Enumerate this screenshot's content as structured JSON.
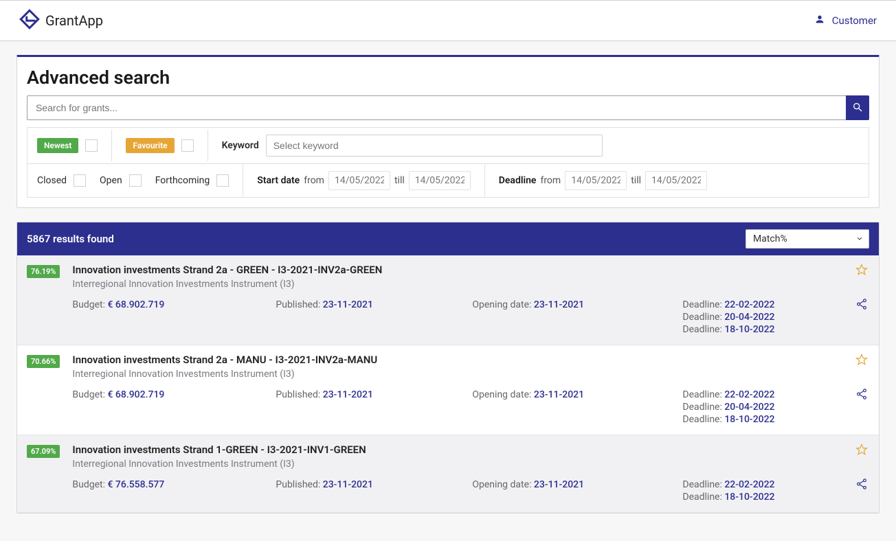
{
  "brand": {
    "name": "GrantApp"
  },
  "user": {
    "label": "Customer"
  },
  "page": {
    "title": "Advanced search"
  },
  "search": {
    "placeholder": "Search for grants..."
  },
  "filters": {
    "newest_pill": "Newest",
    "favourite_pill": "Favourite",
    "keyword_label": "Keyword",
    "keyword_placeholder": "Select keyword",
    "closed_label": "Closed",
    "open_label": "Open",
    "forthcoming_label": "Forthcoming",
    "start_date_label": "Start date",
    "deadline_label": "Deadline",
    "from_label": "from",
    "till_label": "till",
    "date_placeholder": "14/05/2022"
  },
  "results": {
    "count_text": "5867 results found",
    "sort_label": "Match%",
    "items": [
      {
        "match": "76.19%",
        "title": "Innovation investments Strand 2a - GREEN - I3-2021-INV2a-GREEN",
        "subtitle": "Interregional Innovation Investments Instrument (I3)",
        "budget_label": "Budget: ",
        "budget_value": "€ 68.902.719",
        "published_label": "Published: ",
        "published_value": "23-11-2021",
        "opening_label": "Opening date: ",
        "opening_value": "23-11-2021",
        "deadline_label": "Deadline: ",
        "deadlines": [
          "22-02-2022",
          "20-04-2022",
          "18-10-2022"
        ]
      },
      {
        "match": "70.66%",
        "title": "Innovation investments Strand 2a - MANU - I3-2021-INV2a-MANU",
        "subtitle": "Interregional Innovation Investments Instrument (I3)",
        "budget_label": "Budget: ",
        "budget_value": "€ 68.902.719",
        "published_label": "Published: ",
        "published_value": "23-11-2021",
        "opening_label": "Opening date: ",
        "opening_value": "23-11-2021",
        "deadline_label": "Deadline: ",
        "deadlines": [
          "22-02-2022",
          "20-04-2022",
          "18-10-2022"
        ]
      },
      {
        "match": "67.09%",
        "title": "Innovation investments Strand 1-GREEN - I3-2021-INV1-GREEN",
        "subtitle": "Interregional Innovation Investments Instrument (I3)",
        "budget_label": "Budget: ",
        "budget_value": "€ 76.558.577",
        "published_label": "Published: ",
        "published_value": "23-11-2021",
        "opening_label": "Opening date: ",
        "opening_value": "23-11-2021",
        "deadline_label": "Deadline: ",
        "deadlines": [
          "22-02-2022",
          "18-10-2022"
        ]
      }
    ]
  }
}
